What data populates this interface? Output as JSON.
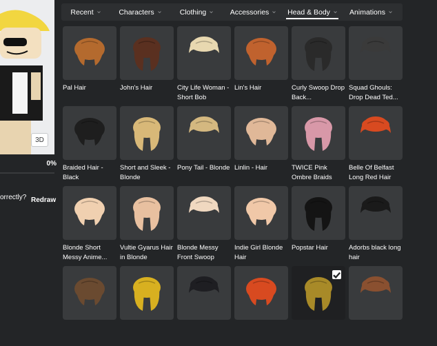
{
  "viewer": {
    "button_3d": "3D",
    "progress_text": "0%",
    "progress_fraction": 0.0,
    "render_question": "orrectly?",
    "redraw_label": "Redraw"
  },
  "nav": {
    "tabs": [
      {
        "label": "Recent",
        "active": false
      },
      {
        "label": "Characters",
        "active": false
      },
      {
        "label": "Clothing",
        "active": false
      },
      {
        "label": "Accessories",
        "active": false
      },
      {
        "label": "Head & Body",
        "active": true
      },
      {
        "label": "Animations",
        "active": false
      }
    ]
  },
  "items": [
    {
      "name": "Pal Hair",
      "color": "#b46a2e"
    },
    {
      "name": "John's Hair",
      "color": "#5a3020"
    },
    {
      "name": "City Life Woman - Short Bob",
      "color": "#e8d8b0"
    },
    {
      "name": "Lin's Hair",
      "color": "#c0622e"
    },
    {
      "name": "Curly Swoop Drop Back...",
      "color": "#2a2a2a"
    },
    {
      "name": "Squad Ghouls: Drop Dead Ted...",
      "color": "#3a3a3a"
    },
    {
      "name": "Braided Hair - Black",
      "color": "#1e1e1e"
    },
    {
      "name": "Short and Sleek - Blonde",
      "color": "#d8b878"
    },
    {
      "name": "Pony Tail - Blonde",
      "color": "#d4b880"
    },
    {
      "name": "Linlin - Hair",
      "color": "#e0b898"
    },
    {
      "name": "TWICE Pink Ombre Braids",
      "color": "#d898a8"
    },
    {
      "name": "Belle Of Belfast Long Red Hair",
      "color": "#d84a20"
    },
    {
      "name": "Blonde Short Messy Anime...",
      "color": "#f0d0b0"
    },
    {
      "name": "Vultie Gyarus Hair in Blonde",
      "color": "#e8c0a0"
    },
    {
      "name": "Blonde Messy Front Swoop",
      "color": "#f0d8c0"
    },
    {
      "name": "Indie Girl Blonde Hair",
      "color": "#f0c8a8"
    },
    {
      "name": "Popstar Hair",
      "color": "#141414"
    },
    {
      "name": "Adorbs black long hair",
      "color": "#1a1a1a"
    },
    {
      "name": "",
      "color": "#6a4a30"
    },
    {
      "name": "",
      "color": "#d8b020"
    },
    {
      "name": "",
      "color": "#1e1e22"
    },
    {
      "name": "",
      "color": "#d84a20"
    },
    {
      "name": "",
      "color": "#a88a28",
      "selected": true
    },
    {
      "name": "",
      "color": "#8a5030"
    }
  ]
}
